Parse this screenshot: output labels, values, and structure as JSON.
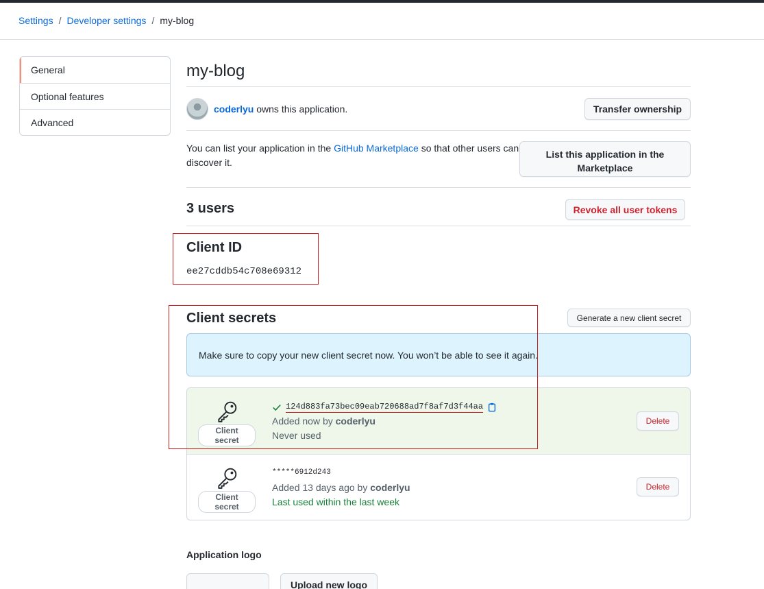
{
  "breadcrumb": {
    "settings": "Settings",
    "sep1": "/",
    "developer": "Developer settings",
    "sep2": "/",
    "current": "my-blog"
  },
  "sidebar": {
    "items": [
      {
        "label": "General",
        "active": true
      },
      {
        "label": "Optional features"
      },
      {
        "label": "Advanced"
      }
    ]
  },
  "app": {
    "title": "my-blog",
    "owner_name": "coderlyu",
    "owner_suffix": "owns this application.",
    "transfer_button": "Transfer ownership",
    "market_pre": "You can list your application in the",
    "market_link": "GitHub Marketplace",
    "market_post": "so that other users can discover it.",
    "market_button_line1": "List this application in the",
    "market_button_line2": "Marketplace"
  },
  "users": {
    "title": "3 users",
    "revoke_button": "Revoke all user tokens"
  },
  "client_id": {
    "title": "Client ID",
    "value": "ee27cddb54c708e69312"
  },
  "client_secrets": {
    "title": "Client secrets",
    "generate_button": "Generate a new client secret",
    "flash": "Make sure to copy your new client secret now. You won’t be able to see it again.",
    "secrets": [
      {
        "badge": "Client secret",
        "value": "124d883fa73bec09eab720688ad7f8af7d3f44aa",
        "added_prefix": "Added now by",
        "added_by": "coderlyu",
        "usage": "Never used",
        "delete": "Delete"
      },
      {
        "badge": "Client secret",
        "value": "*****6912d243",
        "added_prefix": "Added 13 days ago by",
        "added_by": "coderlyu",
        "usage": "Last used within the last week",
        "delete": "Delete"
      }
    ]
  },
  "logo": {
    "title": "Application logo",
    "upload_button": "Upload new logo"
  },
  "colors": {
    "link": "#0969da",
    "danger": "#cf222e",
    "success": "#1a7f37",
    "highlight_border": "#cf1b1b"
  }
}
